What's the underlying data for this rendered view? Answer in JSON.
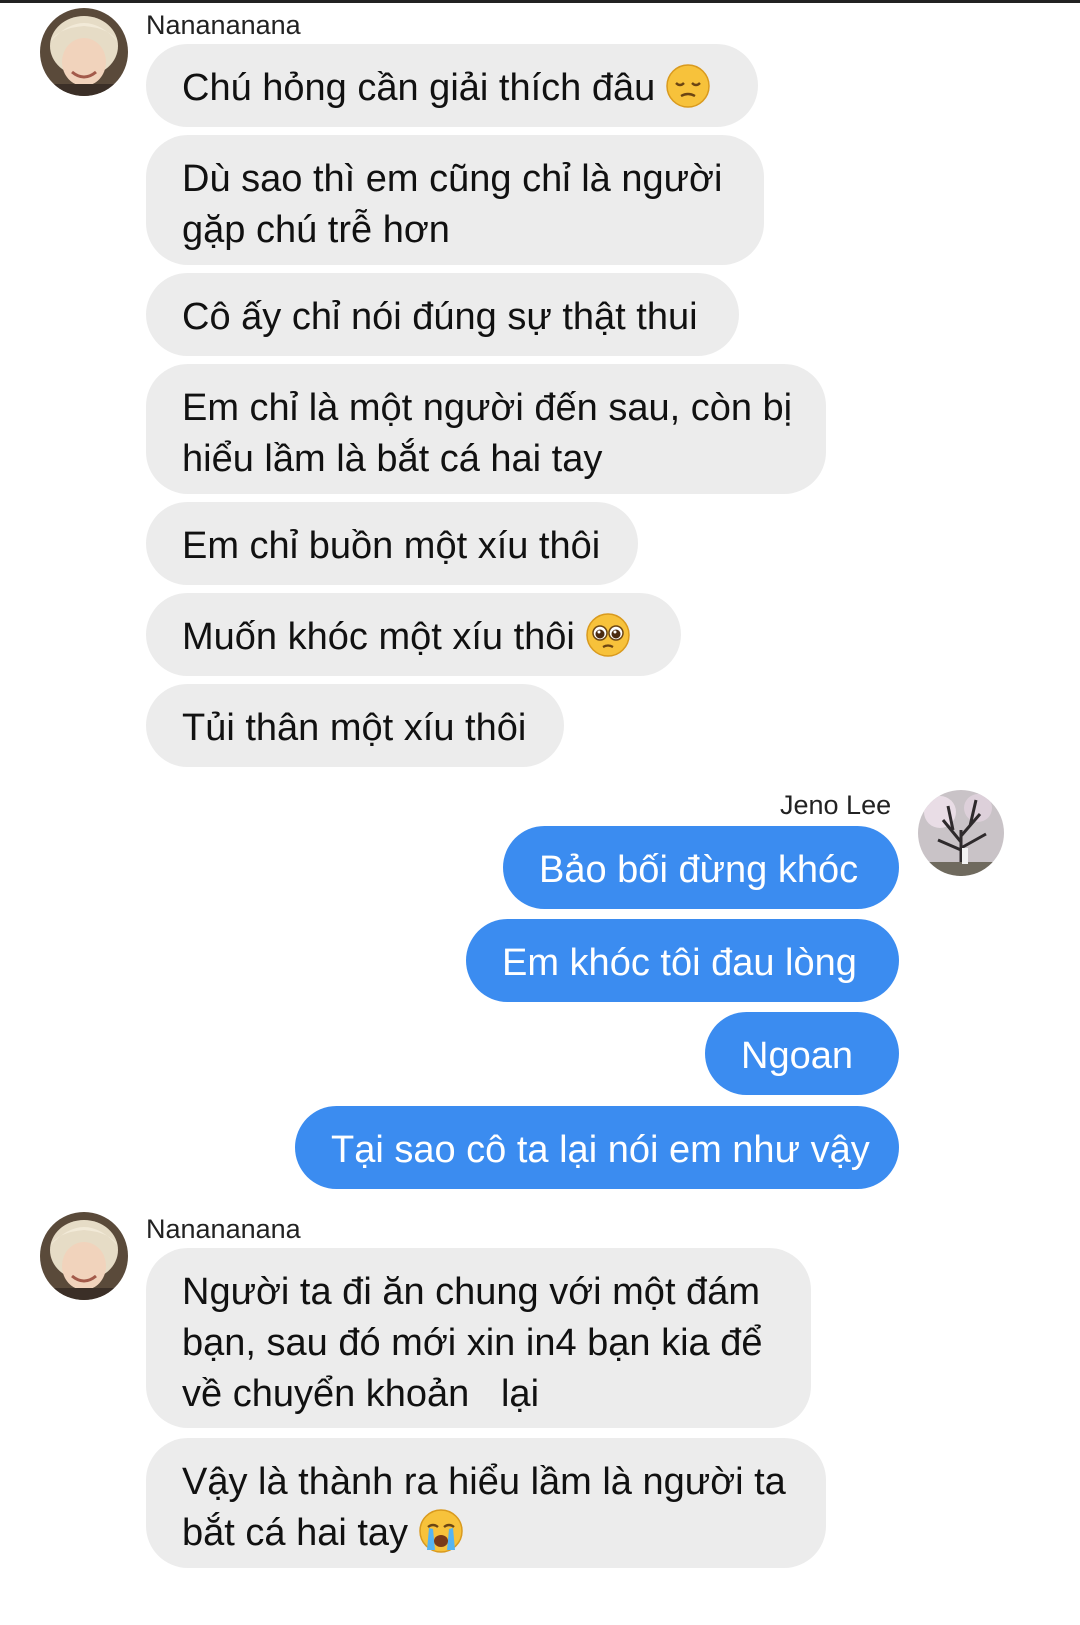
{
  "conversation": {
    "contact_name_top": "Nanananana",
    "contact_name_bottom": "Nanananana",
    "self_name": "Jeno Lee",
    "incoming_1": [
      {
        "text": "Chú hỏng cần giải thích đâu",
        "emoji": "pensive-face"
      },
      {
        "lines": [
          "Dù sao thì em cũng chỉ là người",
          "gặp chú trễ hơn"
        ]
      },
      {
        "text": "Cô ấy chỉ nói đúng sự thật thui"
      },
      {
        "lines": [
          "Em chỉ là một người đến sau, còn bị",
          "hiểu lầm là bắt cá hai tay"
        ]
      },
      {
        "text": "Em chỉ buồn một xíu thôi"
      },
      {
        "text": "Muốn khóc một xíu thôi",
        "emoji": "pleading-face"
      },
      {
        "text": "Tủi thân một xíu thôi"
      }
    ],
    "outgoing": [
      {
        "text": "Bảo bối đừng khóc"
      },
      {
        "text": "Em khóc tôi đau lòng"
      },
      {
        "text": "Ngoan"
      },
      {
        "text": "Tại sao cô ta lại nói em như vậy"
      }
    ],
    "incoming_2": [
      {
        "lines": [
          "Người ta đi ăn chung với một đám",
          "bạn, sau đó mới xin in4 bạn kia để",
          "về chuyển khoản   lại"
        ]
      },
      {
        "lines": [
          "Vậy là thành ra hiểu lầm là người ta",
          "bắt cá hai tay"
        ],
        "emoji": "loudly-crying-face"
      }
    ]
  },
  "colors": {
    "incoming_bubble": "#ececec",
    "outgoing_bubble": "#3b8cf0",
    "outgoing_text": "#ffffff",
    "incoming_text": "#111111"
  }
}
